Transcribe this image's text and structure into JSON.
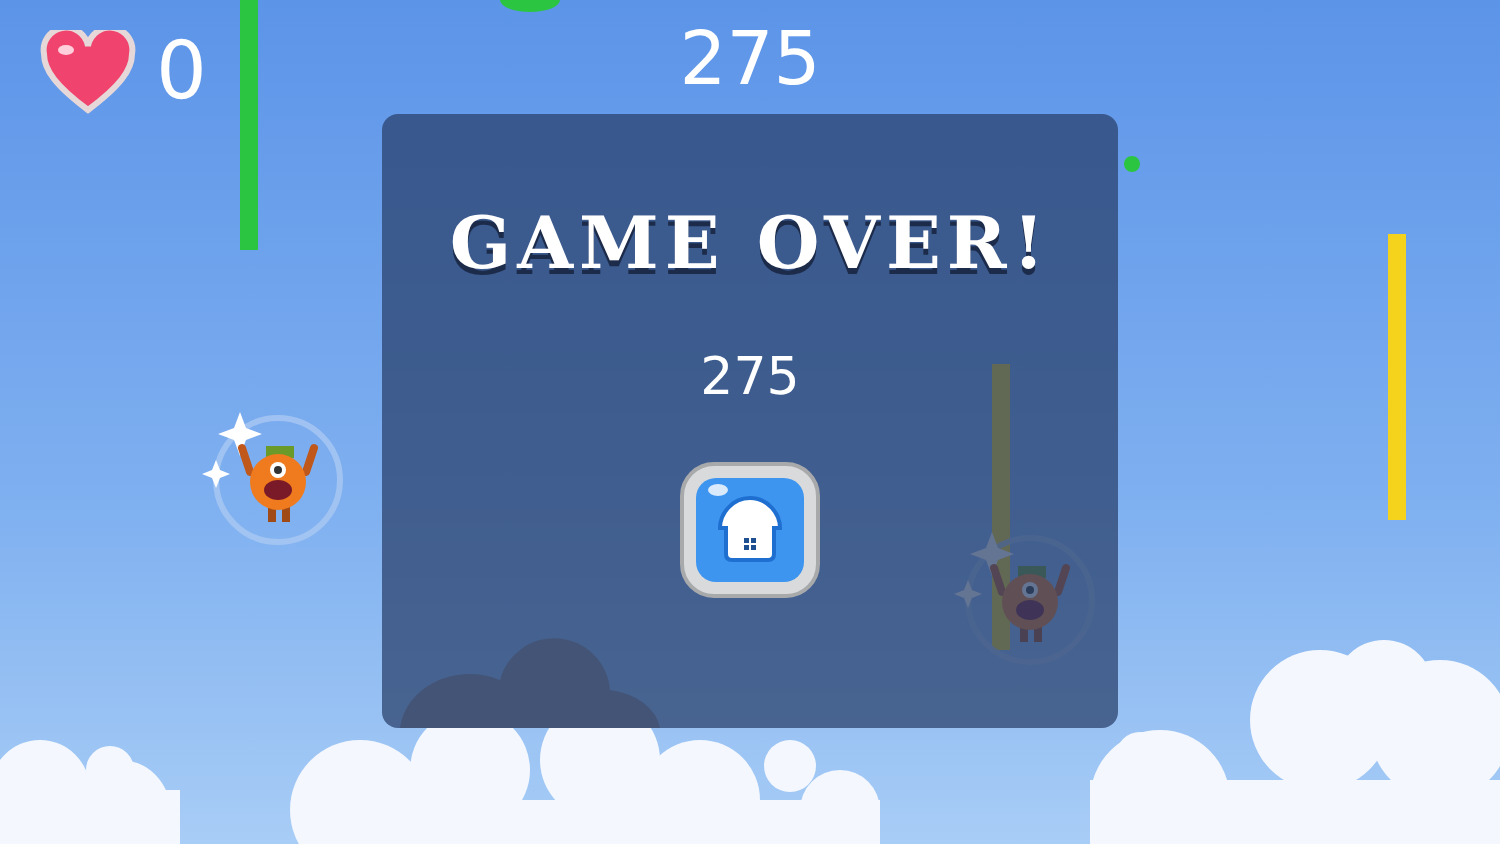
{
  "hud": {
    "lives": "0",
    "score": "275"
  },
  "dialog": {
    "title": "GAME OVER!",
    "score": "275"
  }
}
